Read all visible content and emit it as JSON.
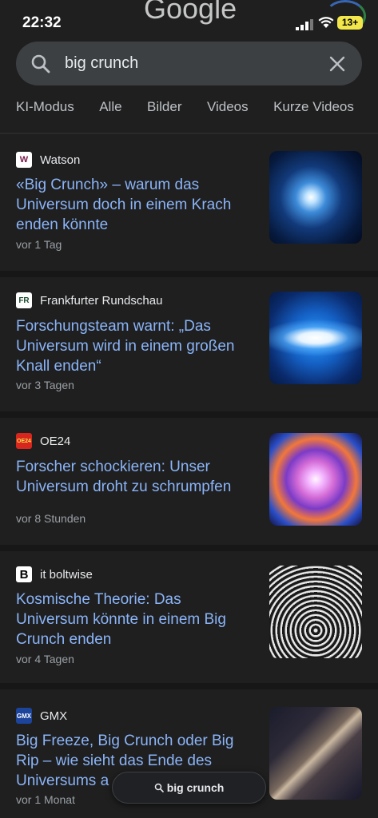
{
  "status": {
    "time": "22:32",
    "battery": "13+",
    "logo_text": "Google"
  },
  "search": {
    "query": "big crunch"
  },
  "tabs": [
    "KI-Modus",
    "Alle",
    "Bilder",
    "Videos",
    "Kurze Videos"
  ],
  "results": [
    {
      "source": "Watson",
      "favicon_text": "W",
      "title": "«Big Crunch» – warum das Universum doch in einem Krach enden könnte",
      "time": "vor 1 Tag",
      "thumb_icon": "galaxy-burst-image"
    },
    {
      "source": "Frankfurter Rundschau",
      "favicon_text": "FR",
      "title": "Forschungsteam warnt: „Das Universum wird in einem großen Knall enden“",
      "time": "vor 3 Tagen",
      "thumb_icon": "light-burst-image"
    },
    {
      "source": "OE24",
      "favicon_text": "OE24",
      "title": "Forscher schockieren: Unser Universum droht zu schrumpfen",
      "time": "vor 8 Stunden",
      "thumb_icon": "colorful-explosion-image"
    },
    {
      "source": "it boltwise",
      "favicon_text": "B",
      "title": "Kosmische Theorie: Das Universum könnte in einem Big Crunch enden",
      "time": "vor 4 Tagen",
      "thumb_icon": "spiral-art-image"
    },
    {
      "source": "GMX",
      "favicon_text": "GMX",
      "title": "Big Freeze, Big Crunch oder Big Rip – wie sieht das Ende des Universums a",
      "time": "vor 1 Monat",
      "thumb_icon": "milky-way-image"
    }
  ],
  "floating_search": {
    "label": "big crunch"
  },
  "colors": {
    "link": "#8ab4f8",
    "background": "#1f1f1f",
    "search_bg": "#3c4043"
  }
}
